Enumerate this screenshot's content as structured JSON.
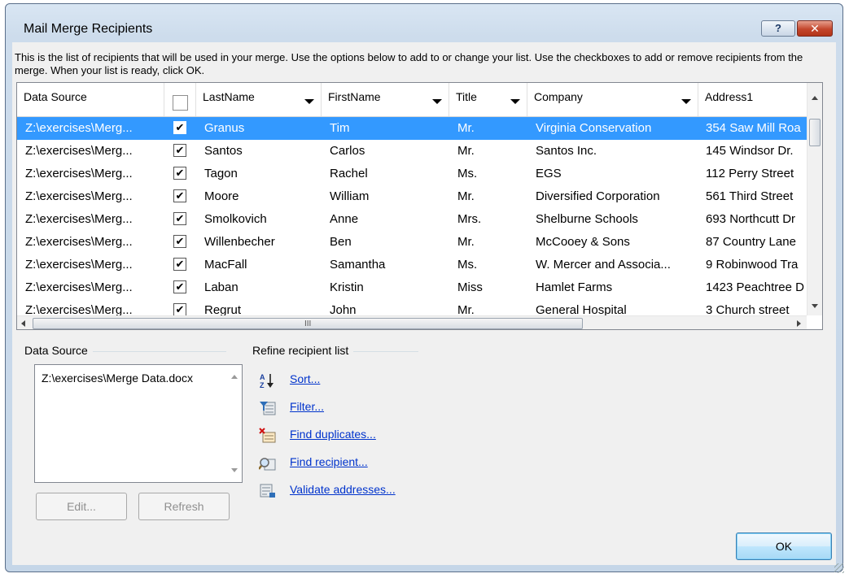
{
  "window": {
    "title": "Mail Merge Recipients",
    "help_glyph": "?",
    "close_glyph": "✕"
  },
  "description": "This is the list of recipients that will be used in your merge.  Use the options below to add to or change your list.  Use the checkboxes to add or remove recipients from the merge.  When your list is ready, click OK.",
  "grid": {
    "columns": [
      "Data Source",
      "LastName",
      "FirstName",
      "Title",
      "Company",
      "Address1"
    ],
    "rows": [
      {
        "source": "Z:\\exercises\\Merg...",
        "checked": "✔",
        "last": "Granus",
        "first": "Tim",
        "title": "Mr.",
        "company": "Virginia Conservation",
        "address": "354 Saw Mill Roa"
      },
      {
        "source": "Z:\\exercises\\Merg...",
        "checked": "✔",
        "last": "Santos",
        "first": "Carlos",
        "title": "Mr.",
        "company": "Santos Inc.",
        "address": "145 Windsor Dr."
      },
      {
        "source": "Z:\\exercises\\Merg...",
        "checked": "✔",
        "last": "Tagon",
        "first": "Rachel",
        "title": "Ms.",
        "company": "EGS",
        "address": "112 Perry Street"
      },
      {
        "source": "Z:\\exercises\\Merg...",
        "checked": "✔",
        "last": "Moore",
        "first": "William",
        "title": "Mr.",
        "company": "Diversified Corporation",
        "address": "561 Third Street"
      },
      {
        "source": "Z:\\exercises\\Merg...",
        "checked": "✔",
        "last": "Smolkovich",
        "first": "Anne",
        "title": "Mrs.",
        "company": "Shelburne Schools",
        "address": "693 Northcutt Dr"
      },
      {
        "source": "Z:\\exercises\\Merg...",
        "checked": "✔",
        "last": "Willenbecher",
        "first": "Ben",
        "title": "Mr.",
        "company": "McCooey & Sons",
        "address": "87 Country Lane"
      },
      {
        "source": "Z:\\exercises\\Merg...",
        "checked": "✔",
        "last": "MacFall",
        "first": "Samantha",
        "title": "Ms.",
        "company": "W. Mercer and Associa...",
        "address": "9 Robinwood Tra"
      },
      {
        "source": "Z:\\exercises\\Merg...",
        "checked": "✔",
        "last": "Laban",
        "first": "Kristin",
        "title": "Miss",
        "company": "Hamlet Farms",
        "address": "1423 Peachtree D"
      },
      {
        "source": "Z:\\exercises\\Merg...",
        "checked": "✔",
        "last": "Regrut",
        "first": "John",
        "title": "Mr.",
        "company": "General Hospital",
        "address": "3 Church street"
      }
    ],
    "scroll_grip": "III"
  },
  "data_source": {
    "label": "Data Source",
    "items": [
      "Z:\\exercises\\Merge Data.docx"
    ],
    "edit_label": "Edit...",
    "refresh_label": "Refresh"
  },
  "refine": {
    "label": "Refine recipient list",
    "actions": [
      {
        "label": "Sort...",
        "icon": "sort-az-icon"
      },
      {
        "label": "Filter...",
        "icon": "filter-icon"
      },
      {
        "label": "Find duplicates...",
        "icon": "find-duplicates-icon"
      },
      {
        "label": "Find recipient...",
        "icon": "find-recipient-icon"
      },
      {
        "label": "Validate addresses...",
        "icon": "validate-addresses-icon"
      }
    ]
  },
  "ok_label": "OK",
  "colors": {
    "selection": "#3399ff",
    "link": "#0033cc",
    "titlebar": "#cddcec"
  }
}
